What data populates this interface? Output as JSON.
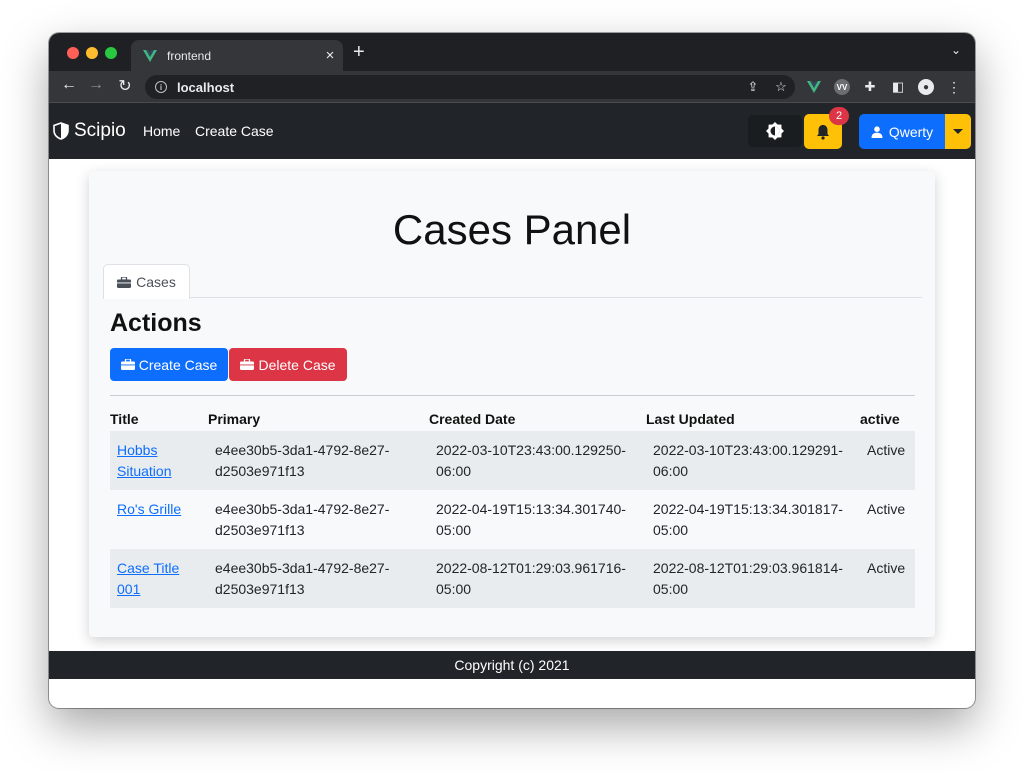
{
  "browser": {
    "tab_title": "frontend",
    "url": "localhost"
  },
  "navbar": {
    "brand": "Scipio",
    "links": [
      "Home",
      "Create Case"
    ],
    "notification_count": "2",
    "user_name": "Qwerty"
  },
  "page": {
    "title": "Cases Panel",
    "tab_label": "Cases",
    "actions_heading": "Actions",
    "create_button": "Create Case",
    "delete_button": "Delete Case"
  },
  "table": {
    "columns": [
      "Title",
      "Primary",
      "Created Date",
      "Last Updated",
      "active"
    ],
    "rows": [
      {
        "title": "Hobbs Situation",
        "primary": "e4ee30b5-3da1-4792-8e27-d2503e971f13",
        "created": "2022-03-10T23:43:00.129250-06:00",
        "updated": "2022-03-10T23:43:00.129291-06:00",
        "active": "Active"
      },
      {
        "title": "Ro's Grille",
        "primary": "e4ee30b5-3da1-4792-8e27-d2503e971f13",
        "created": "2022-04-19T15:13:34.301740-05:00",
        "updated": "2022-04-19T15:13:34.301817-05:00",
        "active": "Active"
      },
      {
        "title": "Case Title 001",
        "primary": "e4ee30b5-3da1-4792-8e27-d2503e971f13",
        "created": "2022-08-12T01:29:03.961716-05:00",
        "updated": "2022-08-12T01:29:03.961814-05:00",
        "active": "Active"
      }
    ]
  },
  "footer": {
    "text": "Copyright (c) 2021"
  },
  "colors": {
    "primary": "#0d6efd",
    "danger": "#dc3545",
    "warning": "#ffc107",
    "dark": "#212529"
  },
  "icons": {
    "brand": "shield-icon",
    "theme": "contrast-gear-icon",
    "notifications": "bell-icon",
    "user": "person-icon",
    "case": "briefcase-icon"
  }
}
